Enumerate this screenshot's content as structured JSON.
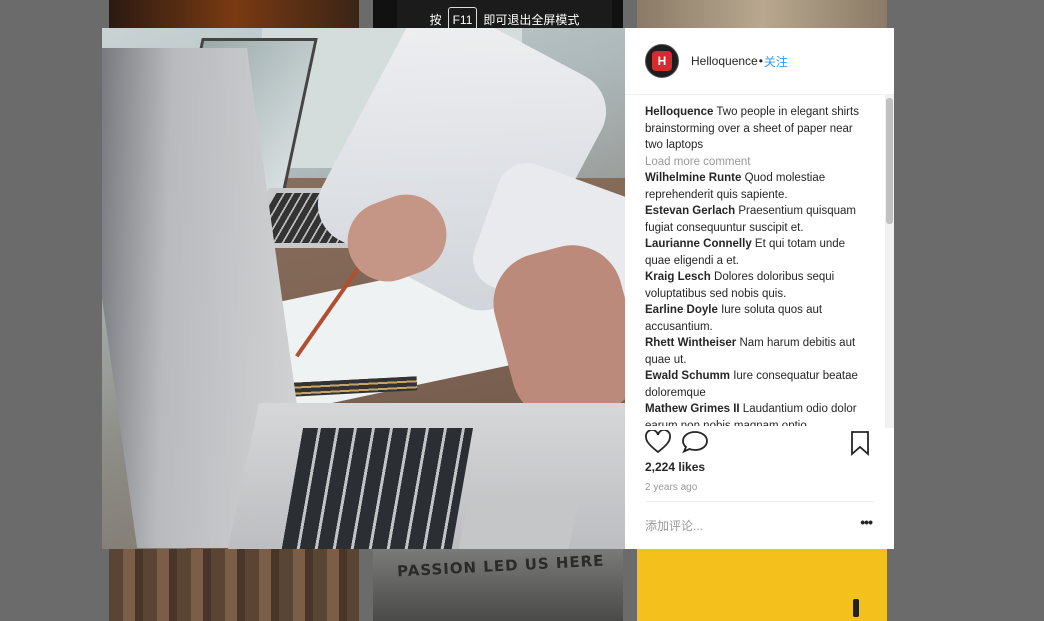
{
  "toast": {
    "before": "按",
    "key": "F11",
    "after": "即可退出全屏模式"
  },
  "background_tiles": {
    "slogan": "PASSION LED US HERE"
  },
  "post": {
    "avatar_letter": "H",
    "username": "Helloquence",
    "dot": "•",
    "follow_label": "关注",
    "caption_user": "Helloquence",
    "caption_text": "Two people in elegant shirts brainstorming over a sheet of paper near two laptops",
    "load_more": "Load more comment",
    "comments": [
      {
        "user": "Wilhelmine Runte",
        "text": "Quod molestiae reprehenderit quis sapiente."
      },
      {
        "user": "Estevan Gerlach",
        "text": "Praesentium quisquam fugiat consequuntur suscipit et."
      },
      {
        "user": "Laurianne Connelly",
        "text": "Et qui totam unde quae eligendi a et."
      },
      {
        "user": "Kraig Lesch",
        "text": "Dolores doloribus sequi voluptatibus sed nobis quis."
      },
      {
        "user": "Earline Doyle",
        "text": "Iure soluta quos aut accusantium."
      },
      {
        "user": "Rhett Wintheiser",
        "text": "Nam harum debitis aut quae ut."
      },
      {
        "user": "Ewald Schumm",
        "text": "Iure consequatur beatae doloremque"
      },
      {
        "user": "Mathew Grimes II",
        "text": "Laudantium odio dolor earum non nobis magnam optio."
      }
    ],
    "likes": "2,224 likes",
    "time_ago": "2 years ago",
    "add_comment_placeholder": "添加评论...",
    "more_label": "•••"
  },
  "icons": {
    "like": "heart-icon",
    "comment": "comment-icon",
    "save": "bookmark-icon"
  }
}
